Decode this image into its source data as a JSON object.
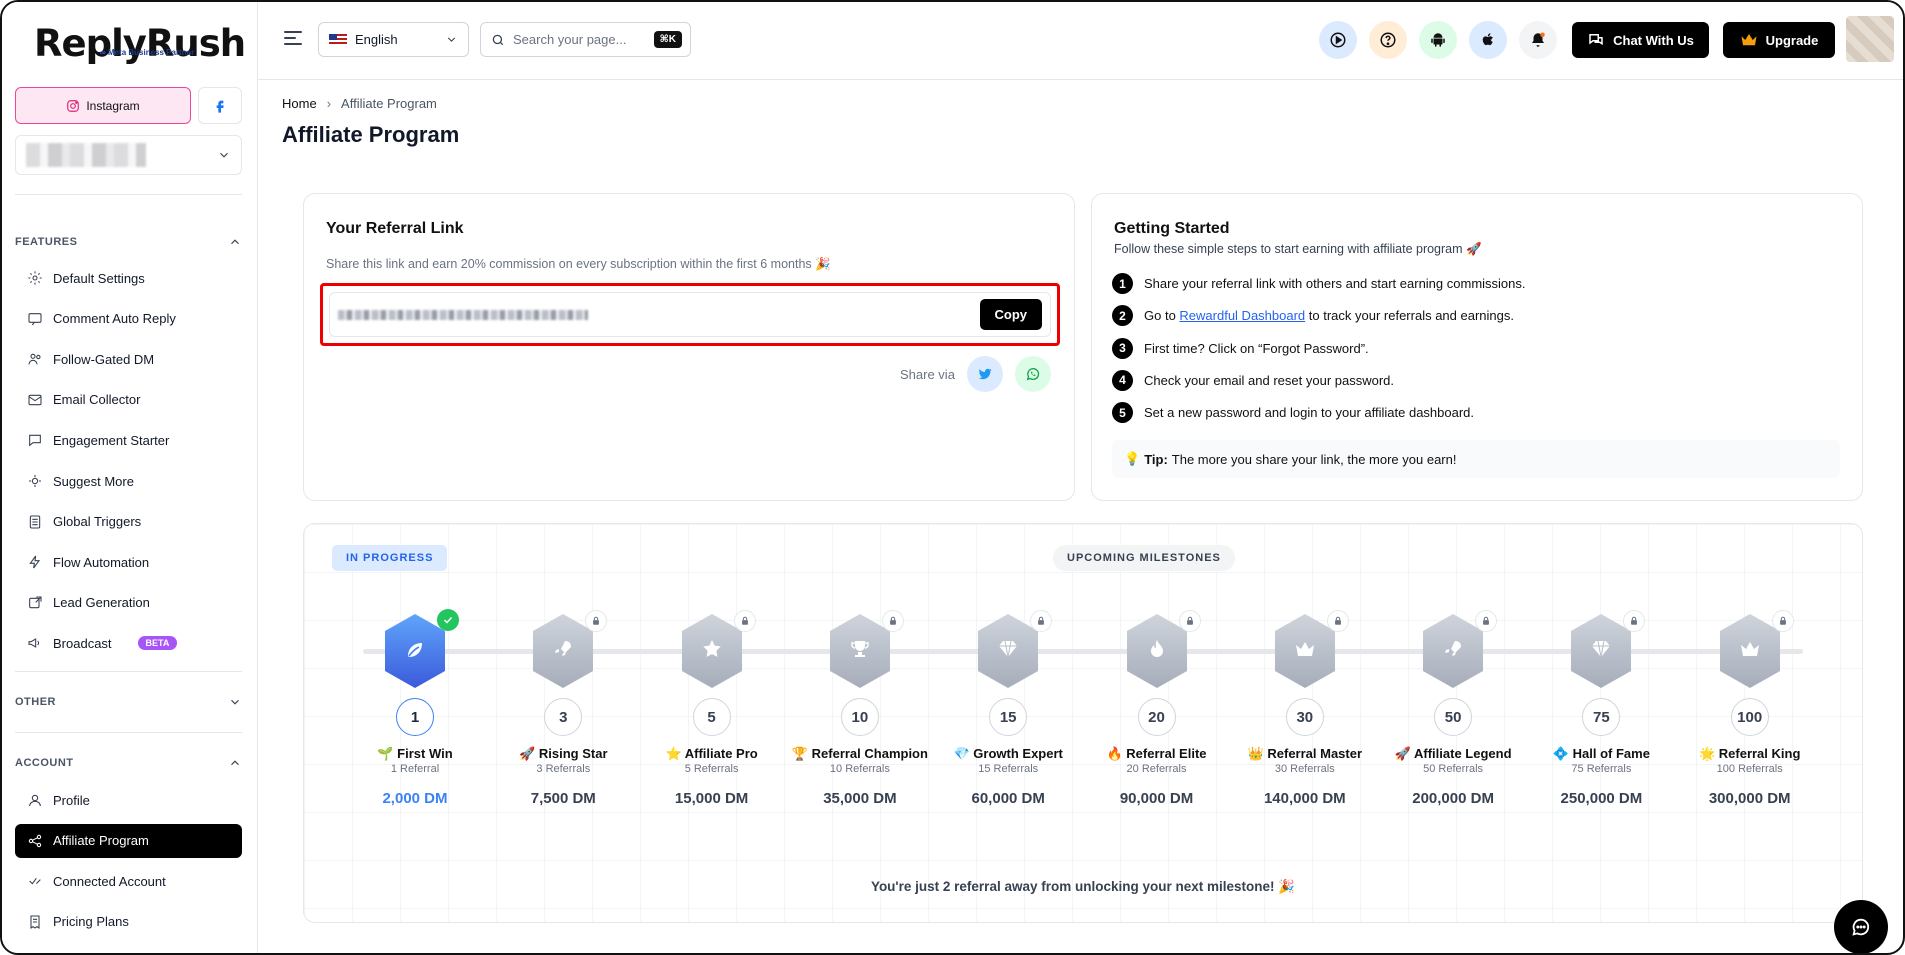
{
  "brand": {
    "name": "ReplyRush",
    "partner": "Meta Business Partner"
  },
  "sidebar": {
    "instagram_label": "Instagram",
    "features_label": "FEATURES",
    "other_label": "OTHER",
    "account_label": "ACCOUNT",
    "features": [
      {
        "label": "Default Settings",
        "icon": "gear-icon"
      },
      {
        "label": "Comment Auto Reply",
        "icon": "comment-icon"
      },
      {
        "label": "Follow-Gated DM",
        "icon": "users-icon"
      },
      {
        "label": "Email Collector",
        "icon": "mail-icon"
      },
      {
        "label": "Engagement Starter",
        "icon": "message-icon"
      },
      {
        "label": "Suggest More",
        "icon": "sparkle-gear-icon"
      },
      {
        "label": "Global Triggers",
        "icon": "list-icon"
      },
      {
        "label": "Flow Automation",
        "icon": "bolt-icon"
      },
      {
        "label": "Lead Generation",
        "icon": "lead-icon"
      },
      {
        "label": "Broadcast",
        "icon": "broadcast-icon",
        "badge": "BETA"
      }
    ],
    "account": [
      {
        "label": "Profile",
        "icon": "user-icon"
      },
      {
        "label": "Affiliate Program",
        "icon": "share-icon",
        "active": true
      },
      {
        "label": "Connected Account",
        "icon": "connected-icon"
      },
      {
        "label": "Pricing Plans",
        "icon": "receipt-icon"
      }
    ]
  },
  "header": {
    "language": "English",
    "search_placeholder": "Search your page...",
    "search_shortcut": "⌘K",
    "chat_label": "Chat With Us",
    "upgrade_label": "Upgrade"
  },
  "breadcrumb": {
    "home": "Home",
    "sep": "›",
    "current": "Affiliate Program"
  },
  "page_title": "Affiliate Program",
  "referral": {
    "title": "Your Referral Link",
    "description": "Share this link and earn 20% commission on every subscription within the first 6 months 🎉",
    "copy_label": "Copy",
    "share_via": "Share via"
  },
  "getting_started": {
    "title": "Getting Started",
    "subtitle": "Follow these simple steps to start earning with affiliate program 🚀",
    "steps": [
      {
        "num": "1",
        "text": "Share your referral link with others and start earning commissions."
      },
      {
        "num": "2",
        "pre": "Go to ",
        "link": "Rewardful Dashboard",
        "post": " to track your referrals and earnings."
      },
      {
        "num": "3",
        "text": "First time? Click on “Forgot Password”."
      },
      {
        "num": "4",
        "text": "Check your email and reset your password."
      },
      {
        "num": "5",
        "text": "Set a new password and login to your affiliate dashboard."
      }
    ],
    "tip_label": "Tip:",
    "tip_text": "The more you share your link, the more you earn!",
    "tip_emoji": "💡"
  },
  "milestones": {
    "in_progress_label": "IN PROGRESS",
    "upcoming_label": "UPCOMING MILESTONES",
    "footer": "You're just 2 referral away from unlocking your next milestone! 🎉",
    "items": [
      {
        "count": "1",
        "emoji": "🌱",
        "title": "First Win",
        "sub": "1 Referral",
        "reward": "2,000 DM",
        "status": "done",
        "icon": "leaf-icon"
      },
      {
        "count": "3",
        "emoji": "🚀",
        "title": "Rising Star",
        "sub": "3 Referrals",
        "reward": "7,500 DM",
        "status": "locked",
        "icon": "rocket-icon"
      },
      {
        "count": "5",
        "emoji": "⭐",
        "title": "Affiliate Pro",
        "sub": "5 Referrals",
        "reward": "15,000 DM",
        "status": "locked",
        "icon": "star-icon"
      },
      {
        "count": "10",
        "emoji": "🏆",
        "title": "Referral Champion",
        "sub": "10 Referrals",
        "reward": "35,000 DM",
        "status": "locked",
        "icon": "trophy-icon"
      },
      {
        "count": "15",
        "emoji": "💎",
        "title": "Growth Expert",
        "sub": "15 Referrals",
        "reward": "60,000 DM",
        "status": "locked",
        "icon": "diamond-icon"
      },
      {
        "count": "20",
        "emoji": "🔥",
        "title": "Referral Elite",
        "sub": "20 Referrals",
        "reward": "90,000 DM",
        "status": "locked",
        "icon": "flame-icon"
      },
      {
        "count": "30",
        "emoji": "👑",
        "title": "Referral Master",
        "sub": "30 Referrals",
        "reward": "140,000 DM",
        "status": "locked",
        "icon": "crown-icon"
      },
      {
        "count": "50",
        "emoji": "🚀",
        "title": "Affiliate Legend",
        "sub": "50 Referrals",
        "reward": "200,000 DM",
        "status": "locked",
        "icon": "rocket-icon"
      },
      {
        "count": "75",
        "emoji": "💠",
        "title": "Hall of Fame",
        "sub": "75 Referrals",
        "reward": "250,000 DM",
        "status": "locked",
        "icon": "diamond-icon"
      },
      {
        "count": "100",
        "emoji": "🌟",
        "title": "Referral King",
        "sub": "100 Referrals",
        "reward": "300,000 DM",
        "status": "locked",
        "icon": "crown-icon"
      }
    ]
  },
  "colors": {
    "accent": "#3b82f6",
    "active_nav": "#000000",
    "highlight_border": "#ef0000",
    "instagram_bg": "#fce7f3",
    "beta": "#a855f7"
  }
}
